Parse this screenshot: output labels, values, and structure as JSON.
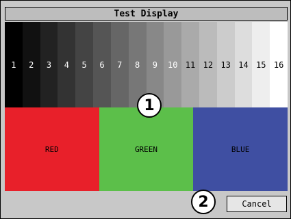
{
  "window": {
    "title": "Test Display"
  },
  "grayscale": {
    "labels": [
      "1",
      "2",
      "3",
      "4",
      "5",
      "6",
      "7",
      "8",
      "9",
      "10",
      "11",
      "12",
      "13",
      "14",
      "15",
      "16"
    ],
    "colors": [
      "#000000",
      "#111111",
      "#222222",
      "#333333",
      "#444444",
      "#555555",
      "#666666",
      "#777777",
      "#888888",
      "#999999",
      "#aaaaaa",
      "#bbbbbb",
      "#cccccc",
      "#dddddd",
      "#eeeeee",
      "#ffffff"
    ]
  },
  "color_bars": [
    {
      "label": "RED",
      "color": "#e8202a"
    },
    {
      "label": "GREEN",
      "color": "#5cbf4a"
    },
    {
      "label": "BLUE",
      "color": "#3f4fa2"
    }
  ],
  "callouts": {
    "one": "1",
    "two": "2"
  },
  "buttons": {
    "cancel": "Cancel"
  }
}
